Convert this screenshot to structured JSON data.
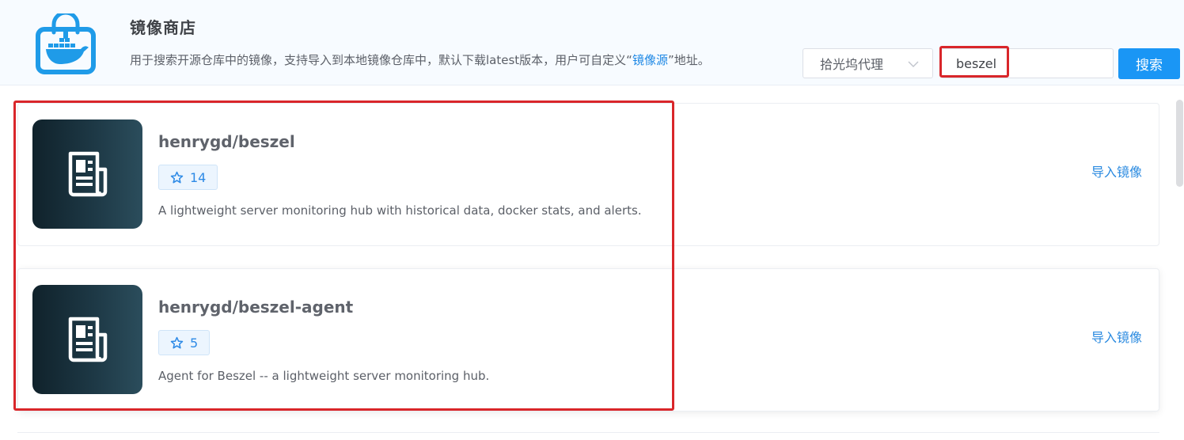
{
  "header": {
    "logo_icon": "docker-store-bag-icon",
    "title": "镜像商店",
    "description_prefix": "用于搜索开源仓库中的镜像，支持导入到本地镜像仓库中，默认下载latest版本，用户可自定义“",
    "description_link": "镜像源",
    "description_suffix": "”地址。"
  },
  "search": {
    "proxy_selected": "拾光坞代理",
    "query_value": "beszel",
    "button_label": "搜索"
  },
  "results": [
    {
      "name": "henrygd/beszel",
      "stars": "14",
      "description": "A lightweight server monitoring hub with historical data, docker stats, and alerts.",
      "action_label": "导入镜像",
      "thumb_icon": "newspaper-icon"
    },
    {
      "name": "henrygd/beszel-agent",
      "stars": "5",
      "description": "Agent for Beszel -- a lightweight server monitoring hub.",
      "action_label": "导入镜像",
      "thumb_icon": "newspaper-icon"
    }
  ],
  "colors": {
    "accent": "#1a96f5",
    "highlight": "#d9262a",
    "thumb_bg": "#1d3845"
  }
}
